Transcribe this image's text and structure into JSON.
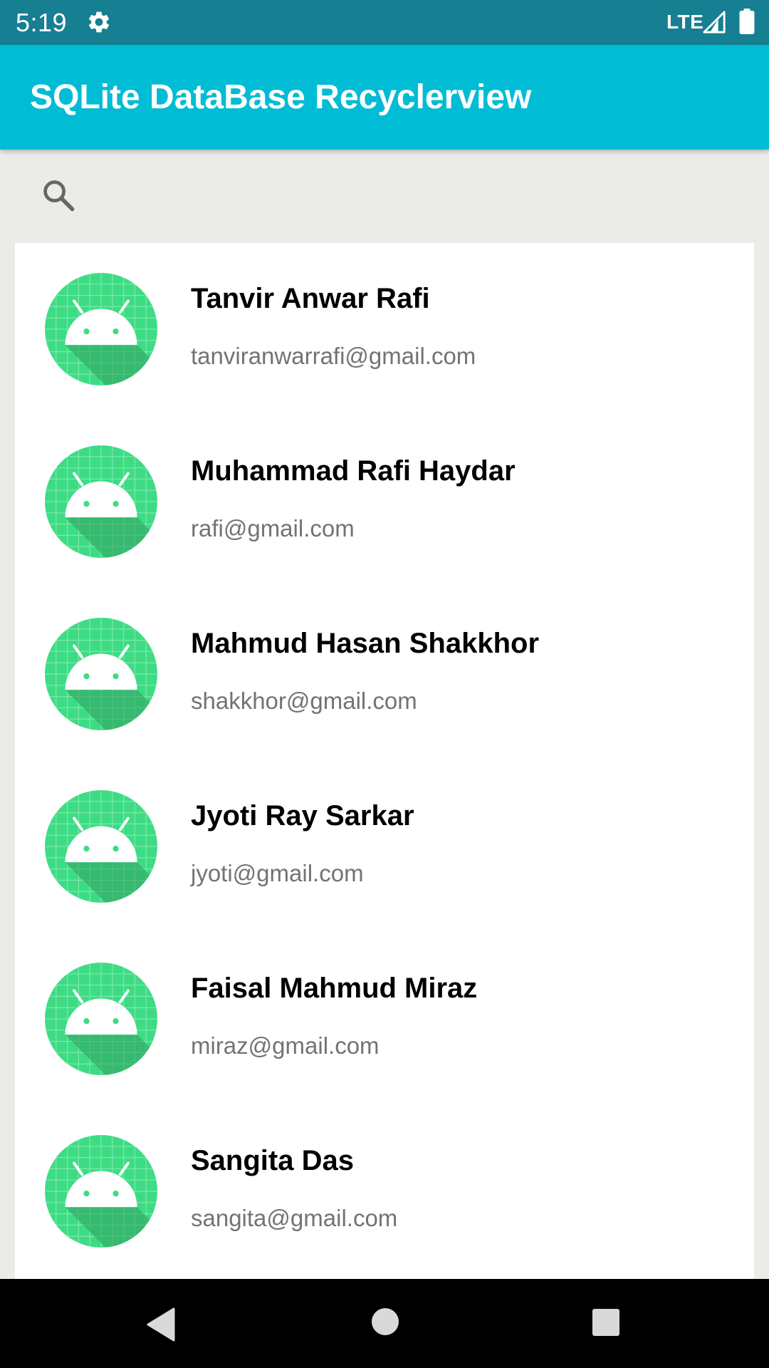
{
  "status_bar": {
    "time": "5:19",
    "network": "LTE",
    "icons": [
      "gear-icon",
      "signal-icon",
      "battery-icon"
    ]
  },
  "app_bar": {
    "title": "SQLite DataBase Recyclerview",
    "color": "#00bcd4"
  },
  "search": {
    "icon": "search-icon"
  },
  "contacts": [
    {
      "name": "Tanvir Anwar Rafi",
      "email": "tanviranwarrafi@gmail.com"
    },
    {
      "name": "Muhammad Rafi Haydar",
      "email": "rafi@gmail.com"
    },
    {
      "name": "Mahmud Hasan Shakkhor",
      "email": "shakkhor@gmail.com"
    },
    {
      "name": "Jyoti Ray Sarkar",
      "email": "jyoti@gmail.com"
    },
    {
      "name": "Faisal Mahmud Miraz",
      "email": "miraz@gmail.com"
    },
    {
      "name": "Sangita Das",
      "email": "sangita@gmail.com"
    }
  ],
  "colors": {
    "status_bar": "#167f91",
    "background": "#ebebe8",
    "avatar": "#3ddc84",
    "email_text": "#737373"
  },
  "nav_bar": {
    "icons": [
      "back-icon",
      "home-icon",
      "recents-icon"
    ]
  }
}
